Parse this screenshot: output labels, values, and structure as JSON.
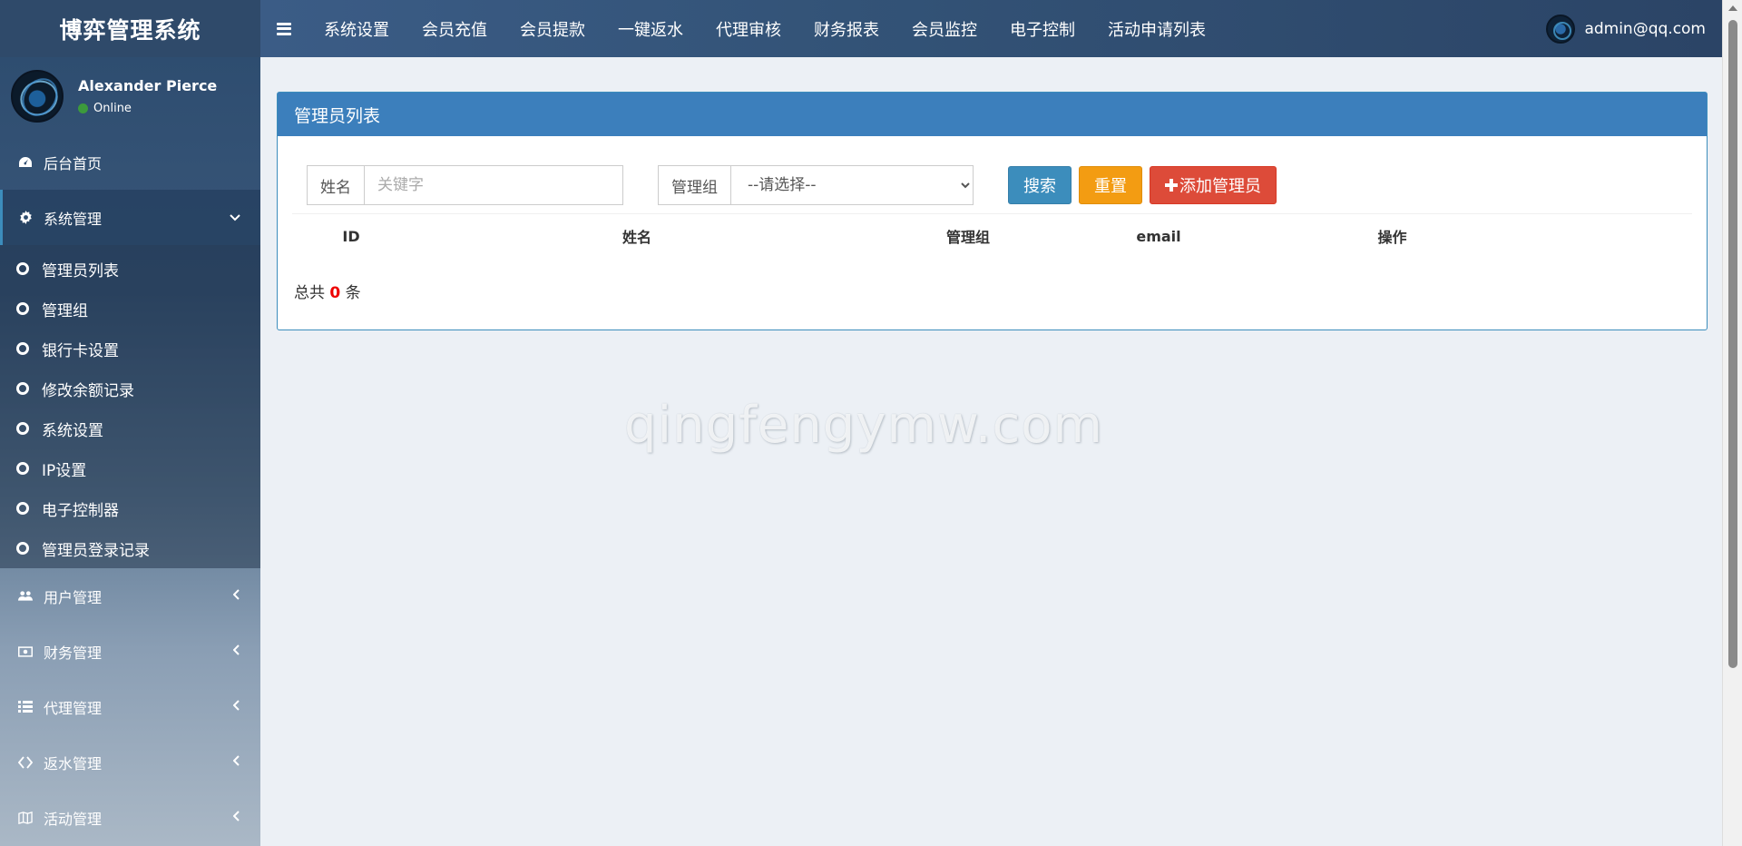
{
  "app": {
    "title": "博弈管理系统"
  },
  "topnav": {
    "items": [
      "系统设置",
      "会员充值",
      "会员提款",
      "一键返水",
      "代理审核",
      "财务报表",
      "会员监控",
      "电子控制",
      "活动申请列表"
    ],
    "user_email": "admin@qq.com"
  },
  "sidebar": {
    "user": {
      "name": "Alexander Pierce",
      "status": "Online"
    },
    "home": "后台首页",
    "system": {
      "label": "系统管理",
      "submenu": [
        "管理员列表",
        "管理组",
        "银行卡设置",
        "修改余额记录",
        "系统设置",
        "IP设置",
        "电子控制器",
        "管理员登录记录"
      ]
    },
    "sections": [
      "用户管理",
      "财务管理",
      "代理管理",
      "返水管理",
      "活动管理"
    ]
  },
  "panel": {
    "title": "管理员列表",
    "filters": {
      "name_label": "姓名",
      "name_placeholder": "关键字",
      "group_label": "管理组",
      "group_selected": "--请选择--"
    },
    "buttons": {
      "search": "搜索",
      "reset": "重置",
      "add": "添加管理员"
    },
    "columns": [
      "ID",
      "姓名",
      "管理组",
      "email",
      "操作"
    ],
    "total_prefix": "总共",
    "total_count": "0",
    "total_suffix": "条"
  },
  "watermark": "qingfengymw.com",
  "colors": {
    "primary": "#3c8dbc",
    "warning": "#f39c12",
    "danger": "#dd4b39",
    "status_online": "#3c9a3c"
  }
}
